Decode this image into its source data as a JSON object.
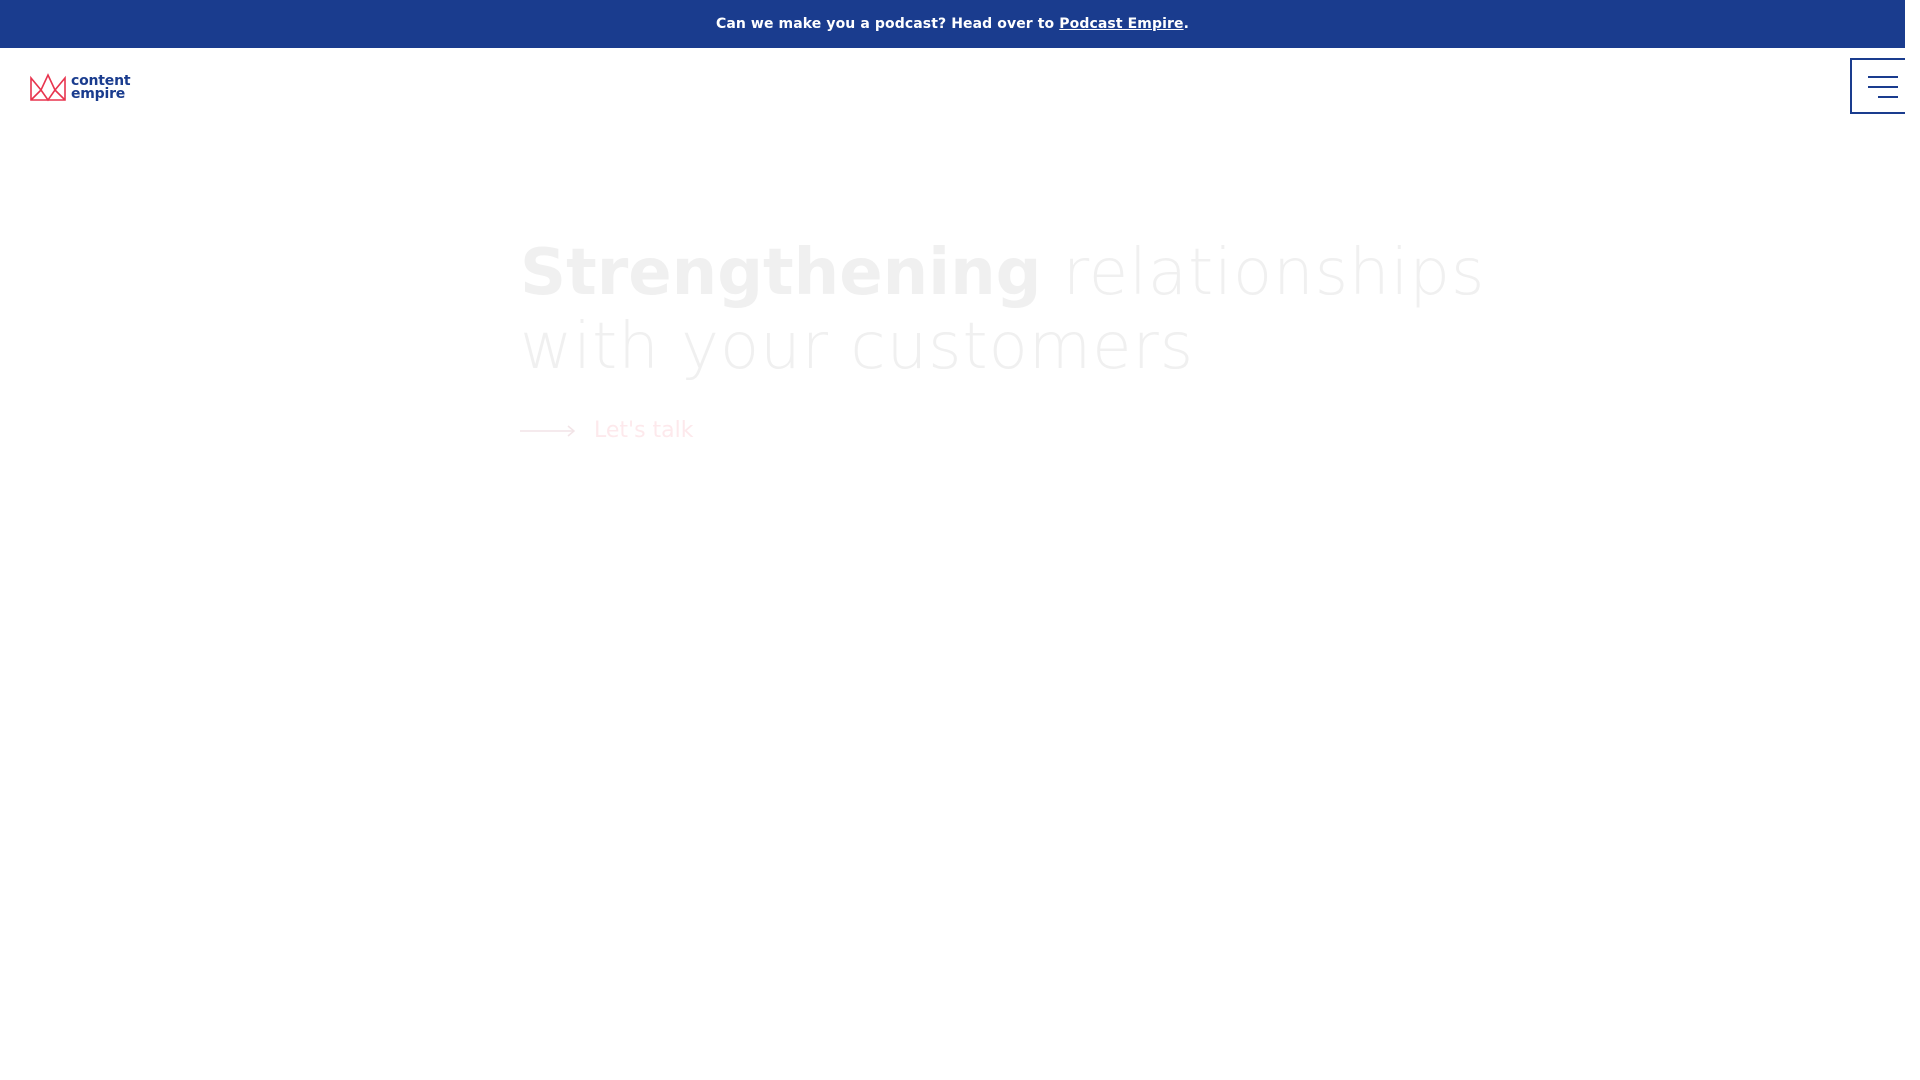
{
  "announcement": {
    "text": "Can we make you a podcast? Head over to",
    "link_text": "Podcast Empire",
    "suffix": "."
  },
  "logo": {
    "line1": "content",
    "line2": "empire",
    "icon": "crown-icon",
    "icon_color": "#e8344e"
  },
  "menu": {
    "icon": "hamburger-icon"
  },
  "hero": {
    "title_bold": "Strengthening",
    "title_light_line1": "relationships",
    "title_light_line2": "with your customers",
    "cta_label": "Let's talk",
    "cta_icon": "arrow-right-icon"
  },
  "scrollbar": {
    "down_arrow": "▼"
  },
  "colors": {
    "brand_blue": "#1a3c8e",
    "brand_red": "#e8344e"
  }
}
